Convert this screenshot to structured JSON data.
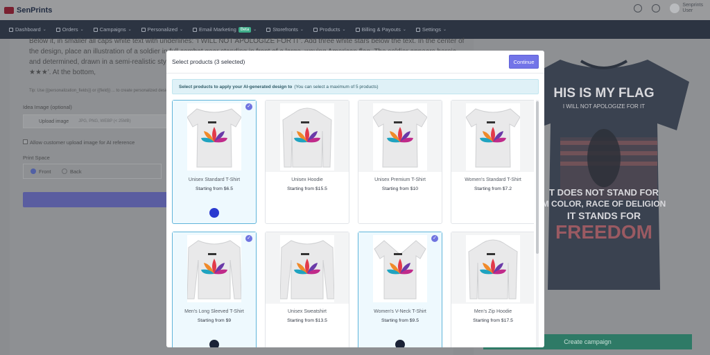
{
  "app": {
    "brand": "SenPrints",
    "user_name": "Senprints",
    "user_sub": "User"
  },
  "nav": [
    {
      "label": "Dashboard",
      "icon": "dashboard-icon"
    },
    {
      "label": "Orders",
      "icon": "orders-icon"
    },
    {
      "label": "Campaigns",
      "icon": "campaigns-icon"
    },
    {
      "label": "Personalized",
      "icon": "personalized-icon"
    },
    {
      "label": "Email Marketing",
      "icon": "email-icon",
      "badge": "Beta"
    },
    {
      "label": "Storefronts",
      "icon": "storefront-icon"
    },
    {
      "label": "Products",
      "icon": "products-icon"
    },
    {
      "label": "Billing & Payouts",
      "icon": "billing-icon"
    },
    {
      "label": "Settings",
      "icon": "settings-icon"
    }
  ],
  "background": {
    "prompt_text": "Below it, in smaller all caps white text with underlines: 'I WILL NOT APOLOGIZE FOR IT'. Add three white stars below the text. In the center of the design, place an illustration of a soldier in full combat gear standing in front of a large, waving American flag. The soldier appears heroic and determined, drawn in a semi-realistic style with strong contrast. Below the soldier, include bold white text: add: '★ IT STANDS FOR ★★★'. At the bottom,",
    "hint": "Tip: Use {{personalization_fields}} or {{field}} ... to create personalized designs",
    "idea_image_label": "Idea Image (optional)",
    "upload_label": "Upload image",
    "upload_hint": "JPG, PNG, WEBP (< 25MB)",
    "allow_upload_label": "Allow customer upload image for AI reference",
    "print_space_label": "Print Space",
    "front_label": "Front",
    "back_label": "Back",
    "create_campaign": "Create campaign"
  },
  "modal": {
    "title": "Select products (3 selected)",
    "continue_label": "Continue",
    "info_bold": "Select products to apply your AI-generated design to",
    "info_rest": "(You can select a maximum of 5 products)",
    "products": [
      {
        "name": "Unisex Standard T-Shirt",
        "price": "Starting from $6.5",
        "selected": true,
        "swatch": "#2a3ad0"
      },
      {
        "name": "Unisex Hoodie",
        "price": "Starting from $15.5",
        "selected": false
      },
      {
        "name": "Unisex Premium T-Shirt",
        "price": "Starting from $10",
        "selected": false
      },
      {
        "name": "Women's Standard T-Shirt",
        "price": "Starting from $7.2",
        "selected": false
      },
      {
        "name": "Men's Long Sleeved T-Shirt",
        "price": "Starting from $9",
        "selected": true,
        "swatch": "#1a2236"
      },
      {
        "name": "Unisex Sweatshirt",
        "price": "Starting from $13.5",
        "selected": false
      },
      {
        "name": "Women's V-Neck T-Shirt",
        "price": "Starting from $9.5",
        "selected": true,
        "swatch": "#1a2236"
      },
      {
        "name": "Men's Zip Hoodie",
        "price": "Starting from $17.5",
        "selected": false
      }
    ]
  },
  "shirt_preview": {
    "line1": "HIS IS MY FLAG",
    "line2": "I WILL NOT APOLOGIZE FOR IT",
    "line3": "T DOES NOT STAND FOR",
    "line4": "M COLOR, RACE OF DELIGION",
    "line5": "IT STANDS FOR",
    "line6": "FREEDOM"
  },
  "colors": {
    "accent": "#7274e8",
    "selected_border": "#5fb4da",
    "info_bg": "#dff1f7",
    "create_btn": "#2e7a66"
  }
}
